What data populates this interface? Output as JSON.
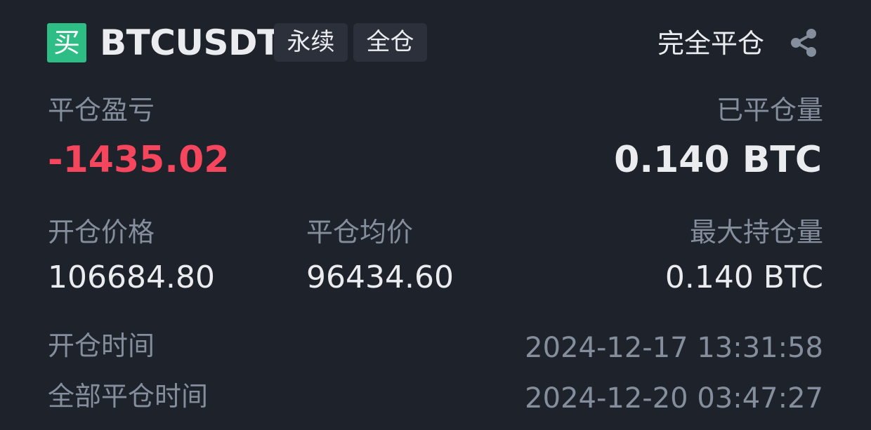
{
  "header": {
    "side_badge": "买",
    "symbol": "BTCUSDT",
    "tags": [
      "永续",
      "全仓"
    ],
    "status": "完全平仓",
    "share_icon": "share-icon"
  },
  "stats": {
    "realized_pnl": {
      "label": "平仓盈亏",
      "value": "-1435.02"
    },
    "closed_amount": {
      "label": "已平仓量",
      "value": "0.140 BTC"
    },
    "entry_price": {
      "label": "开仓价格",
      "value": "106684.80"
    },
    "close_avg_price": {
      "label": "平仓均价",
      "value": "96434.60"
    },
    "max_position": {
      "label": "最大持仓量",
      "value": "0.140 BTC"
    },
    "open_time": {
      "label": "开仓时间",
      "value": "2024-12-17 13:31:58"
    },
    "full_close_time": {
      "label": "全部平仓时间",
      "value": "2024-12-20 03:47:27"
    }
  },
  "colors": {
    "background": "#1e222b",
    "buy": "#2ebd85",
    "loss": "#f6465d",
    "muted": "#848e9c",
    "text": "#eaecef"
  }
}
